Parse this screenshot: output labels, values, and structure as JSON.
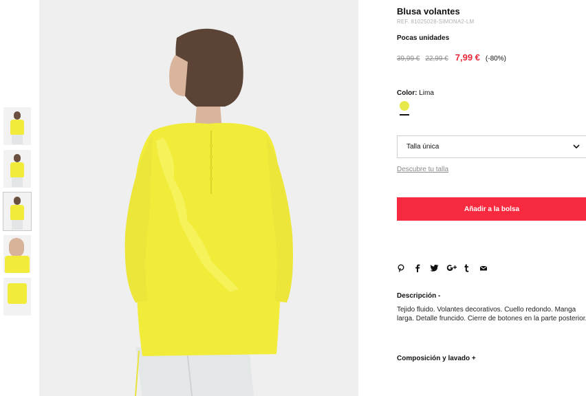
{
  "product": {
    "title": "Blusa volantes",
    "ref": "REF. 81025028-SIMONA2-LM",
    "stock": "Pocas unidades",
    "price_original": "39,99 €",
    "price_previous": "22,99 €",
    "price_current": "7,99 €",
    "discount": "(-80%)",
    "color_label": "Color:",
    "color_value": "Lima",
    "color_swatch": "#e7e84a",
    "size_selected": "Talla única",
    "size_link": "Descubre tu talla",
    "add_to_bag": "Añadir a la bolsa"
  },
  "social": [
    "pinterest-icon",
    "facebook-icon",
    "twitter-icon",
    "google-plus-icon",
    "tumblr-icon",
    "email-icon"
  ],
  "description": {
    "heading": "Descripción -",
    "text": "Tejido fluido. Volantes decorativos. Cuello redondo. Manga larga. Detalle fruncido. Cierre de botones en la parte posterior."
  },
  "composition": {
    "heading": "Composición y lavado +"
  },
  "colors": {
    "accent": "#f72a3f",
    "price": "#e8263a",
    "product": "#f1ec3a"
  }
}
